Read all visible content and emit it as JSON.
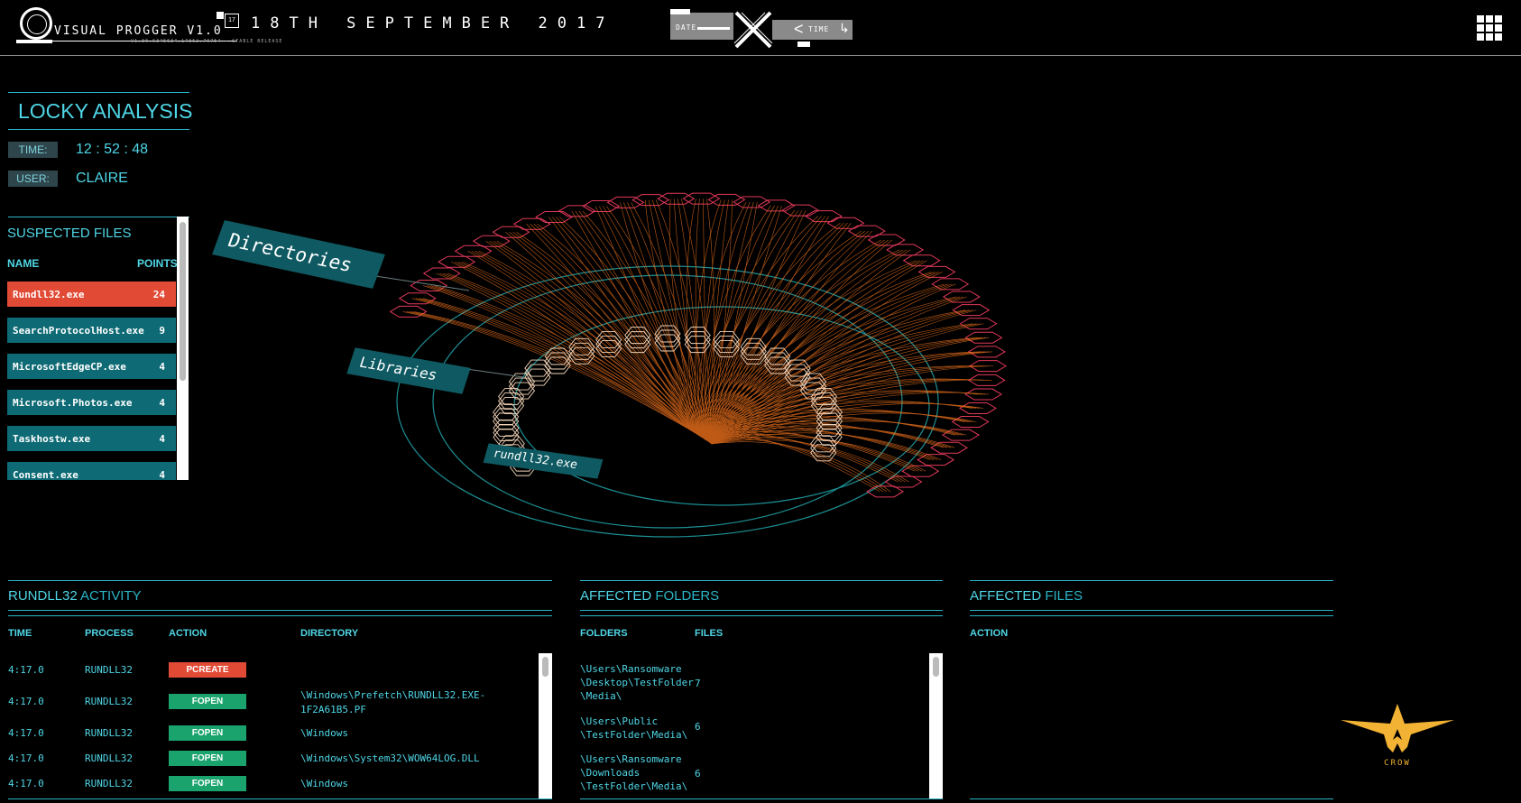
{
  "header": {
    "app_title": "VISUAL PROGGER V1.0",
    "app_subtitle": "V1.30.6345634.17362.79754 - STABLE RELEASE",
    "version_badge": "17",
    "date": "18TH SEPTEMBER 2017",
    "date_control_label": "DATE",
    "time_control_label": "TIME"
  },
  "analysis": {
    "title": "LOCKY ANALYSIS",
    "time_label": "TIME:",
    "time_value": "12 : 52 : 48",
    "user_label": "USER:",
    "user_value": "CLAIRE"
  },
  "suspected_files": {
    "title": "SUSPECTED FILES",
    "col_name": "NAME",
    "col_points": "POINTS",
    "rows": [
      {
        "name": "Rundll32.exe",
        "points": "24"
      },
      {
        "name": "SearchProtocolHost.exe",
        "points": "9"
      },
      {
        "name": "MicrosoftEdgeCP.exe",
        "points": "4"
      },
      {
        "name": "Microsoft.Photos.exe",
        "points": "4"
      },
      {
        "name": "Taskhostw.exe",
        "points": "4"
      },
      {
        "name": "Consent.exe",
        "points": "4"
      }
    ]
  },
  "viz": {
    "label_directories": "Directories",
    "label_libraries": "Libraries",
    "label_process": "rundll32.exe",
    "colors": {
      "lines": "#ff7a1f",
      "hexagons": "#e0385a",
      "libraries": "#f2d3b8",
      "rings": "#1d8f94"
    }
  },
  "activity": {
    "title_main": "RUNDLL32",
    "title_rest": "ACTIVITY",
    "col_time": "TIME",
    "col_process": "PROCESS",
    "col_action": "ACTION",
    "col_directory": "DIRECTORY",
    "rows": [
      {
        "time": "4:17.0",
        "process": "RUNDLL32",
        "action": "PCREATE",
        "directory": ""
      },
      {
        "time": "4:17.0",
        "process": "RUNDLL32",
        "action": "FOPEN",
        "directory_1": "\\Windows\\Prefetch\\RUNDLL32.EXE-",
        "directory_2": "1F2A61B5.PF"
      },
      {
        "time": "4:17.0",
        "process": "RUNDLL32",
        "action": "FOPEN",
        "directory": "\\Windows"
      },
      {
        "time": "4:17.0",
        "process": "RUNDLL32",
        "action": "FOPEN",
        "directory": "\\Windows\\System32\\WOW64LOG.DLL"
      },
      {
        "time": "4:17.0",
        "process": "RUNDLL32",
        "action": "FOPEN",
        "directory": "\\Windows"
      }
    ]
  },
  "folders": {
    "title_main": "AFFECTED",
    "title_rest": "FOLDERS",
    "col_folders": "FOLDERS",
    "col_files": "FILES",
    "rows": [
      {
        "line1": "\\Users\\Ransomware",
        "line2": "\\Desktop\\TestFolder",
        "line3": "\\Media\\",
        "files": "7"
      },
      {
        "line1": "\\Users\\Public",
        "line2": "\\TestFolder\\Media\\",
        "line3": "",
        "files": "6"
      },
      {
        "line1": "\\Users\\Ransomware",
        "line2": "\\Downloads",
        "line3": "\\TestFolder\\Media\\",
        "files": "6"
      }
    ]
  },
  "files": {
    "title_main": "AFFECTED",
    "title_rest": "FILES",
    "col_header": "ACTION"
  },
  "crow_logo": "CROW"
}
